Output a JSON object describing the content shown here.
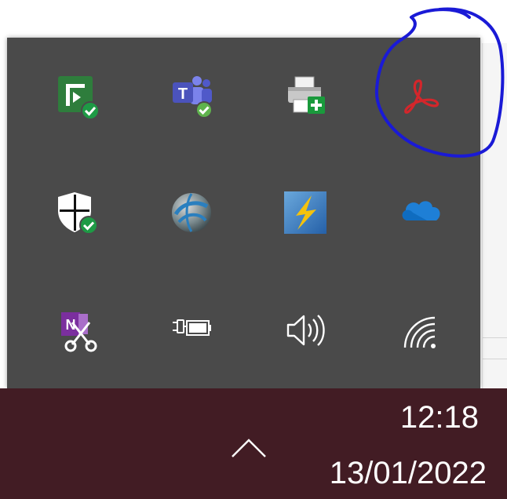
{
  "tray": {
    "rows": [
      [
        {
          "icon": "microsoft-planner-icon",
          "accent": "#2e7d3c"
        },
        {
          "icon": "microsoft-teams-icon",
          "accent": "#5059c9"
        },
        {
          "icon": "printer-add-icon",
          "accent": "#1a9a3c"
        },
        {
          "icon": "adobe-acrobat-icon",
          "accent": "#d4262b"
        }
      ],
      [
        {
          "icon": "windows-security-shield-icon",
          "accent": "#ffffff"
        },
        {
          "icon": "network-globe-icon",
          "accent": "#2a7fbf"
        },
        {
          "icon": "lightning-app-icon",
          "accent": "#3a86c8"
        },
        {
          "icon": "onedrive-cloud-icon",
          "accent": "#1e7fd6"
        }
      ],
      [
        {
          "icon": "onenote-screen-clipper-icon",
          "accent": "#7b2f9e"
        },
        {
          "icon": "battery-charging-icon",
          "accent": "#ffffff"
        },
        {
          "icon": "volume-speaker-icon",
          "accent": "#ffffff"
        },
        {
          "icon": "wifi-signal-icon",
          "accent": "#ffffff"
        }
      ]
    ]
  },
  "taskbar": {
    "clock": {
      "time": "12:18",
      "date": "13/01/2022"
    },
    "show_hidden_icon": "chevron-up-icon"
  },
  "colors": {
    "tray_bg": "#4a4a4a",
    "taskbar_bg": "#421c24",
    "annotation": "#1a1ad6"
  }
}
